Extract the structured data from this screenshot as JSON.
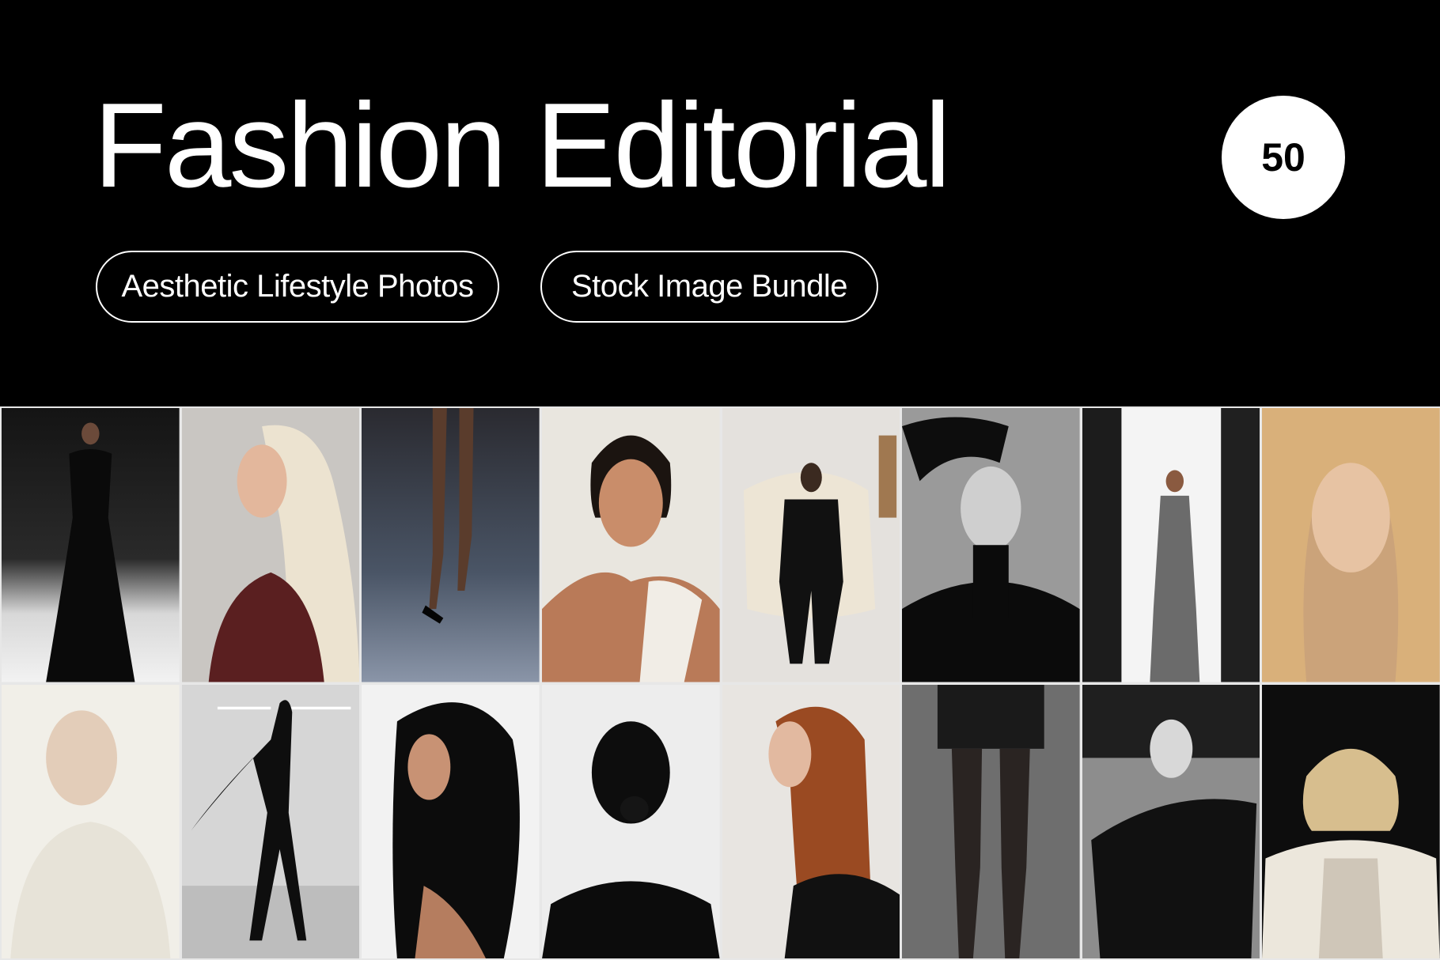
{
  "header": {
    "title": "Fashion Editorial",
    "count": "50",
    "tags": [
      "Aesthetic Lifestyle Photos",
      "Stock Image Bundle"
    ]
  },
  "colors": {
    "background": "#000000",
    "text": "#ffffff",
    "badge_bg": "#ffffff",
    "badge_text": "#000000"
  }
}
